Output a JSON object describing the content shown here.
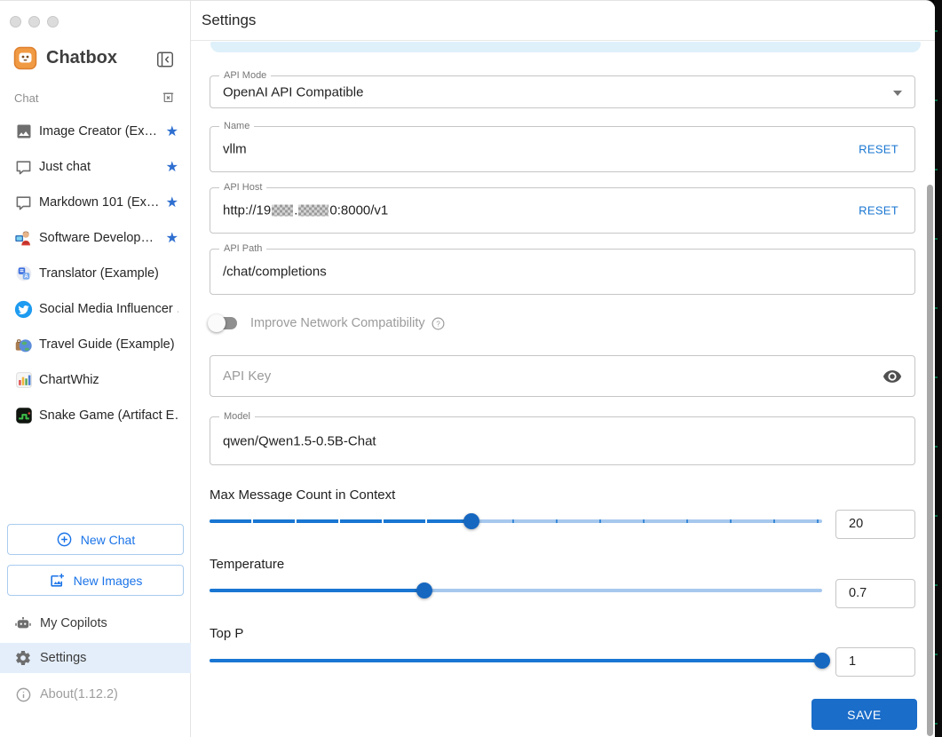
{
  "colors": {
    "accent": "#1976d2",
    "slider_track_light": "#a6c8ed",
    "selected_nav_bg": "#e4eefa",
    "save_button_bg": "#1a6dc9",
    "top_strip": "#def0fa",
    "star": "#2e6fd0",
    "twitter_blue": "#1d9bf0"
  },
  "sidebar": {
    "app_name": "Chatbox",
    "section_label": "Chat",
    "items": [
      {
        "label": "Image Creator (Ex…",
        "icon": "image-icon",
        "starred": true
      },
      {
        "label": "Just chat",
        "icon": "chat-bubble-icon",
        "starred": true
      },
      {
        "label": "Markdown 101 (Ex…",
        "icon": "chat-bubble-icon",
        "starred": true
      },
      {
        "label": "Software Develop…",
        "icon": "developer-avatar-icon",
        "starred": true
      },
      {
        "label": "Translator (Example)",
        "icon": "translate-icon",
        "starred": false
      },
      {
        "label": "Social Media Influencer …",
        "icon": "twitter-icon",
        "starred": false
      },
      {
        "label": "Travel Guide (Example)",
        "icon": "globe-luggage-icon",
        "starred": false
      },
      {
        "label": "ChartWhiz",
        "icon": "bar-chart-icon",
        "starred": false
      },
      {
        "label": "Snake Game (Artifact E…",
        "icon": "snake-game-icon",
        "starred": false
      }
    ],
    "star_glyph": "★",
    "new_chat_label": "New Chat",
    "new_images_label": "New Images",
    "nav": {
      "copilots": "My Copilots",
      "settings": "Settings",
      "about": "About(1.12.2)"
    }
  },
  "main": {
    "header_title": "Settings",
    "api_mode": {
      "label": "API Mode",
      "value": "OpenAI API Compatible"
    },
    "name_field": {
      "label": "Name",
      "value": "vllm",
      "reset_label": "RESET"
    },
    "api_host": {
      "label": "API Host",
      "value_prefix": "http://19",
      "value_mid": ".",
      "value_suffix": "0:8000/v1",
      "reset_label": "RESET",
      "redacted": true
    },
    "api_path": {
      "label": "API Path",
      "value": "/chat/completions"
    },
    "network_toggle": {
      "label": "Improve Network Compatibility",
      "state": "off"
    },
    "api_key": {
      "placeholder": "API Key",
      "value": ""
    },
    "model": {
      "label": "Model",
      "value": "qwen/Qwen1.5-0.5B-Chat"
    },
    "sliders": [
      {
        "label": "Max Message Count in Context",
        "value": "20",
        "fill_style": "width:42.8%",
        "has_marks": true
      },
      {
        "label": "Temperature",
        "value": "0.7",
        "fill_style": "width:35%",
        "has_marks": false
      },
      {
        "label": "Top P",
        "value": "1",
        "fill_style": "width:100%",
        "has_marks": false
      }
    ],
    "save_label": "SAVE"
  },
  "icons": {
    "help_glyph": "?",
    "translator_glyph": "A"
  }
}
